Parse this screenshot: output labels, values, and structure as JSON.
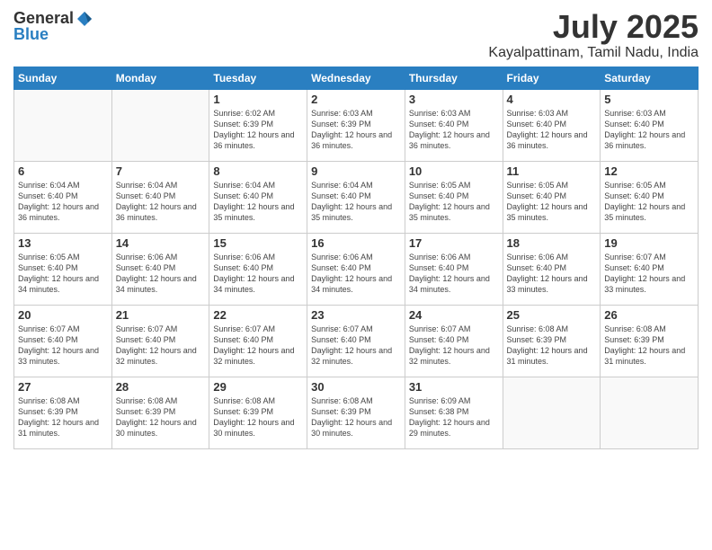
{
  "header": {
    "logo_line1": "General",
    "logo_line2": "Blue",
    "title": "July 2025",
    "subtitle": "Kayalpattinam, Tamil Nadu, India"
  },
  "calendar": {
    "days_of_week": [
      "Sunday",
      "Monday",
      "Tuesday",
      "Wednesday",
      "Thursday",
      "Friday",
      "Saturday"
    ],
    "weeks": [
      [
        {
          "day": "",
          "info": ""
        },
        {
          "day": "",
          "info": ""
        },
        {
          "day": "1",
          "info": "Sunrise: 6:02 AM\nSunset: 6:39 PM\nDaylight: 12 hours and 36 minutes."
        },
        {
          "day": "2",
          "info": "Sunrise: 6:03 AM\nSunset: 6:39 PM\nDaylight: 12 hours and 36 minutes."
        },
        {
          "day": "3",
          "info": "Sunrise: 6:03 AM\nSunset: 6:40 PM\nDaylight: 12 hours and 36 minutes."
        },
        {
          "day": "4",
          "info": "Sunrise: 6:03 AM\nSunset: 6:40 PM\nDaylight: 12 hours and 36 minutes."
        },
        {
          "day": "5",
          "info": "Sunrise: 6:03 AM\nSunset: 6:40 PM\nDaylight: 12 hours and 36 minutes."
        }
      ],
      [
        {
          "day": "6",
          "info": "Sunrise: 6:04 AM\nSunset: 6:40 PM\nDaylight: 12 hours and 36 minutes."
        },
        {
          "day": "7",
          "info": "Sunrise: 6:04 AM\nSunset: 6:40 PM\nDaylight: 12 hours and 36 minutes."
        },
        {
          "day": "8",
          "info": "Sunrise: 6:04 AM\nSunset: 6:40 PM\nDaylight: 12 hours and 35 minutes."
        },
        {
          "day": "9",
          "info": "Sunrise: 6:04 AM\nSunset: 6:40 PM\nDaylight: 12 hours and 35 minutes."
        },
        {
          "day": "10",
          "info": "Sunrise: 6:05 AM\nSunset: 6:40 PM\nDaylight: 12 hours and 35 minutes."
        },
        {
          "day": "11",
          "info": "Sunrise: 6:05 AM\nSunset: 6:40 PM\nDaylight: 12 hours and 35 minutes."
        },
        {
          "day": "12",
          "info": "Sunrise: 6:05 AM\nSunset: 6:40 PM\nDaylight: 12 hours and 35 minutes."
        }
      ],
      [
        {
          "day": "13",
          "info": "Sunrise: 6:05 AM\nSunset: 6:40 PM\nDaylight: 12 hours and 34 minutes."
        },
        {
          "day": "14",
          "info": "Sunrise: 6:06 AM\nSunset: 6:40 PM\nDaylight: 12 hours and 34 minutes."
        },
        {
          "day": "15",
          "info": "Sunrise: 6:06 AM\nSunset: 6:40 PM\nDaylight: 12 hours and 34 minutes."
        },
        {
          "day": "16",
          "info": "Sunrise: 6:06 AM\nSunset: 6:40 PM\nDaylight: 12 hours and 34 minutes."
        },
        {
          "day": "17",
          "info": "Sunrise: 6:06 AM\nSunset: 6:40 PM\nDaylight: 12 hours and 34 minutes."
        },
        {
          "day": "18",
          "info": "Sunrise: 6:06 AM\nSunset: 6:40 PM\nDaylight: 12 hours and 33 minutes."
        },
        {
          "day": "19",
          "info": "Sunrise: 6:07 AM\nSunset: 6:40 PM\nDaylight: 12 hours and 33 minutes."
        }
      ],
      [
        {
          "day": "20",
          "info": "Sunrise: 6:07 AM\nSunset: 6:40 PM\nDaylight: 12 hours and 33 minutes."
        },
        {
          "day": "21",
          "info": "Sunrise: 6:07 AM\nSunset: 6:40 PM\nDaylight: 12 hours and 32 minutes."
        },
        {
          "day": "22",
          "info": "Sunrise: 6:07 AM\nSunset: 6:40 PM\nDaylight: 12 hours and 32 minutes."
        },
        {
          "day": "23",
          "info": "Sunrise: 6:07 AM\nSunset: 6:40 PM\nDaylight: 12 hours and 32 minutes."
        },
        {
          "day": "24",
          "info": "Sunrise: 6:07 AM\nSunset: 6:40 PM\nDaylight: 12 hours and 32 minutes."
        },
        {
          "day": "25",
          "info": "Sunrise: 6:08 AM\nSunset: 6:39 PM\nDaylight: 12 hours and 31 minutes."
        },
        {
          "day": "26",
          "info": "Sunrise: 6:08 AM\nSunset: 6:39 PM\nDaylight: 12 hours and 31 minutes."
        }
      ],
      [
        {
          "day": "27",
          "info": "Sunrise: 6:08 AM\nSunset: 6:39 PM\nDaylight: 12 hours and 31 minutes."
        },
        {
          "day": "28",
          "info": "Sunrise: 6:08 AM\nSunset: 6:39 PM\nDaylight: 12 hours and 30 minutes."
        },
        {
          "day": "29",
          "info": "Sunrise: 6:08 AM\nSunset: 6:39 PM\nDaylight: 12 hours and 30 minutes."
        },
        {
          "day": "30",
          "info": "Sunrise: 6:08 AM\nSunset: 6:39 PM\nDaylight: 12 hours and 30 minutes."
        },
        {
          "day": "31",
          "info": "Sunrise: 6:09 AM\nSunset: 6:38 PM\nDaylight: 12 hours and 29 minutes."
        },
        {
          "day": "",
          "info": ""
        },
        {
          "day": "",
          "info": ""
        }
      ]
    ]
  }
}
